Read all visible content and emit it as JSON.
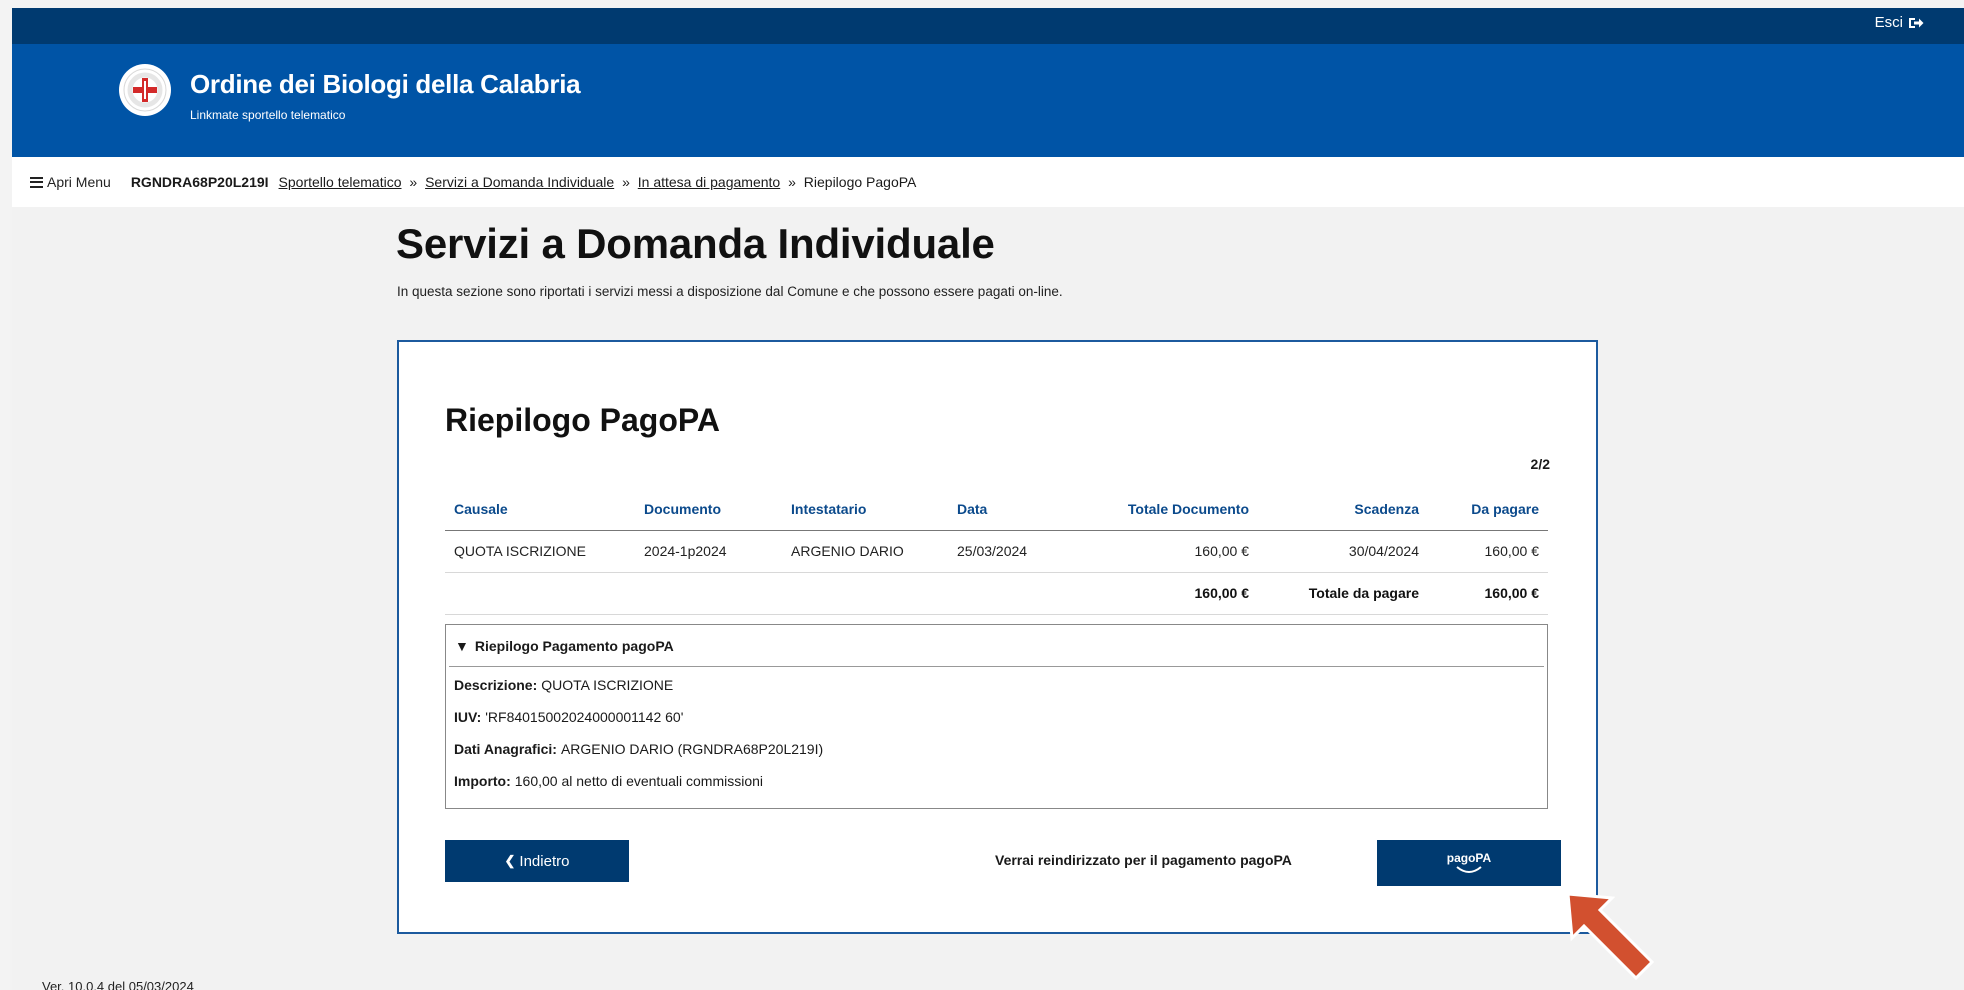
{
  "topbar": {
    "logout_label": "Esci"
  },
  "header": {
    "title": "Ordine dei Biologi della Calabria",
    "subtitle": "Linkmate sportello telematico"
  },
  "navbar": {
    "menu_label": "Apri Menu",
    "user_code": "RGNDRA68P20L219I",
    "breadcrumb": [
      "Sportello telematico",
      "Servizi a Domanda Individuale",
      "In attesa di pagamento",
      "Riepilogo PagoPA"
    ],
    "separator": "»"
  },
  "page": {
    "title": "Servizi a Domanda Individuale",
    "description": "In questa sezione sono riportati i servizi messi a disposizione dal Comune e che possono essere pagati on-line."
  },
  "card": {
    "title": "Riepilogo PagoPA",
    "step": "2/2",
    "table": {
      "headers": [
        "Causale",
        "Documento",
        "Intestatario",
        "Data",
        "Totale Documento",
        "Scadenza",
        "Da pagare"
      ],
      "rows": [
        [
          "QUOTA ISCRIZIONE",
          "2024-1p2024",
          "ARGENIO DARIO",
          "25/03/2024",
          "160,00 €",
          "30/04/2024",
          "160,00 €"
        ]
      ],
      "total_document": "160,00 €",
      "total_label": "Totale da pagare",
      "total_value": "160,00 €"
    },
    "details": {
      "title": "Riepilogo Pagamento pagoPA",
      "descrizione_label": "Descrizione:",
      "descrizione_value": "QUOTA ISCRIZIONE",
      "iuv_label": "IUV:",
      "iuv_value": "'RF84015002024000001142 60'",
      "anagrafici_label": "Dati Anagrafici:",
      "anagrafici_value": "ARGENIO DARIO (RGNDRA68P20L219I)",
      "importo_label": "Importo:",
      "importo_value": "160,00 al netto di eventuali commissioni"
    },
    "back_label": "Indietro",
    "redirect_text": "Verrai reindirizzato per il pagamento pagoPA",
    "pagopa_label": "pagoPA"
  },
  "footer": {
    "version": "Ver. 10.0.4 del 05/03/2024"
  },
  "colors": {
    "topbar": "#003a70",
    "header": "#0054a6",
    "accent": "#0b4a8c",
    "arrow": "#d2502f"
  }
}
